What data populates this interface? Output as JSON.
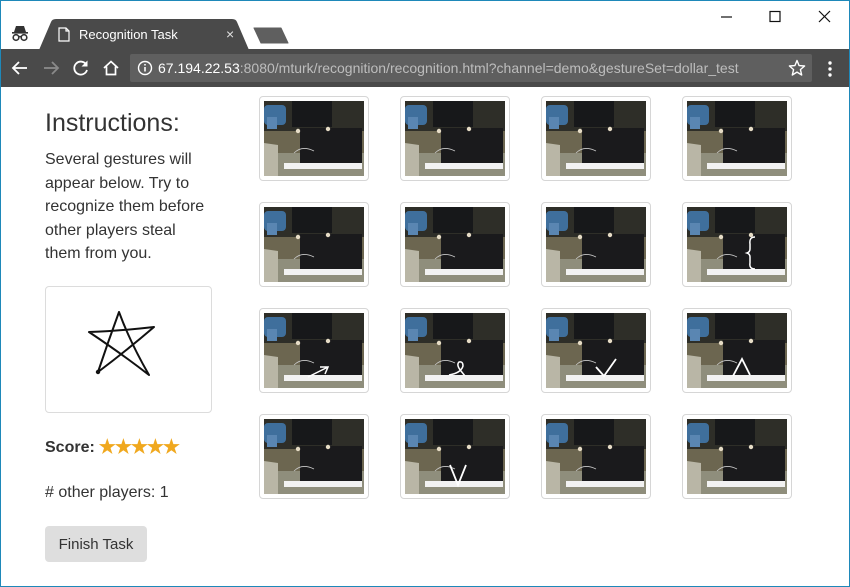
{
  "browser": {
    "tab_title": "Recognition Task",
    "tab_close": "×",
    "url_host": "67.194.22.53",
    "url_rest": ":8080/mturk/recognition/recognition.html?channel=demo&gestureSet=dollar_test"
  },
  "sidebar": {
    "title": "Instructions:",
    "text": "Several gestures will appear below. Try to recognize them before other players steal them from you.",
    "score_label": "Score:",
    "score_stars": 5,
    "players_text": "# other players: 1",
    "finish_label": "Finish Task"
  },
  "thumbnails": [
    {
      "gesture": "none"
    },
    {
      "gesture": "none"
    },
    {
      "gesture": "none"
    },
    {
      "gesture": "none"
    },
    {
      "gesture": "none"
    },
    {
      "gesture": "none"
    },
    {
      "gesture": "none"
    },
    {
      "gesture": "left-brace"
    },
    {
      "gesture": "arrow"
    },
    {
      "gesture": "pigtail"
    },
    {
      "gesture": "check"
    },
    {
      "gesture": "caret"
    },
    {
      "gesture": "none"
    },
    {
      "gesture": "v"
    },
    {
      "gesture": "none"
    },
    {
      "gesture": "none"
    }
  ],
  "colors": {
    "star": "#f0a81e",
    "toolbar": "#4a4a4a",
    "tab": "#4a4a4a",
    "frame": "#1e88b9"
  }
}
